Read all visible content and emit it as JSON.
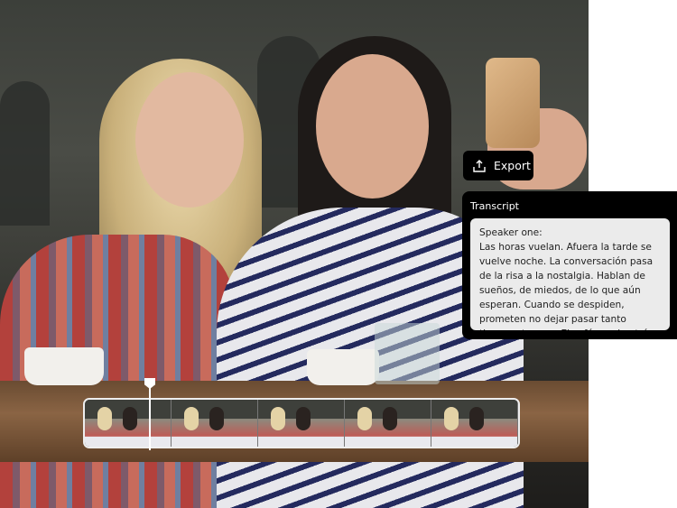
{
  "export_button": {
    "label": "Export",
    "icon": "share-export-icon"
  },
  "transcript": {
    "title": "Transcript",
    "speaker": "Speaker one:",
    "text": "Las horas vuelan. Afuera la tarde se vuelve noche. La conversación pasa de la risa a la nostalgia. Hablan de sueños, de miedos, de lo que aún esperan. Cuando se despiden, prometen no dejar pasar tanto tiempo otra vez. El café queda atrás, pero la amistad va con ellas."
  },
  "timeline": {
    "frame_count": 5
  }
}
